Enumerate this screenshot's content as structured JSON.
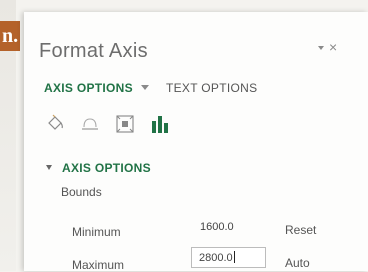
{
  "page_fragment_text": "n.",
  "panel": {
    "title": "Format Axis",
    "close_symbol": "×"
  },
  "tabs": [
    {
      "label": "AXIS OPTIONS",
      "active": true
    },
    {
      "label": "TEXT OPTIONS",
      "active": false
    }
  ],
  "category_icons": [
    "fill-line-icon",
    "effects-icon",
    "size-properties-icon",
    "axis-options-icon"
  ],
  "section": {
    "title": "AXIS OPTIONS",
    "bounds_label": "Bounds",
    "minimum": {
      "label": "Minimum",
      "value": "1600.0",
      "button": "Reset"
    },
    "maximum": {
      "label": "Maximum",
      "value": "2800.0",
      "button": "Auto"
    }
  },
  "colors": {
    "accent": "#217346",
    "title_gray": "#6d6d6d",
    "page_fragment": "#b4622a"
  }
}
